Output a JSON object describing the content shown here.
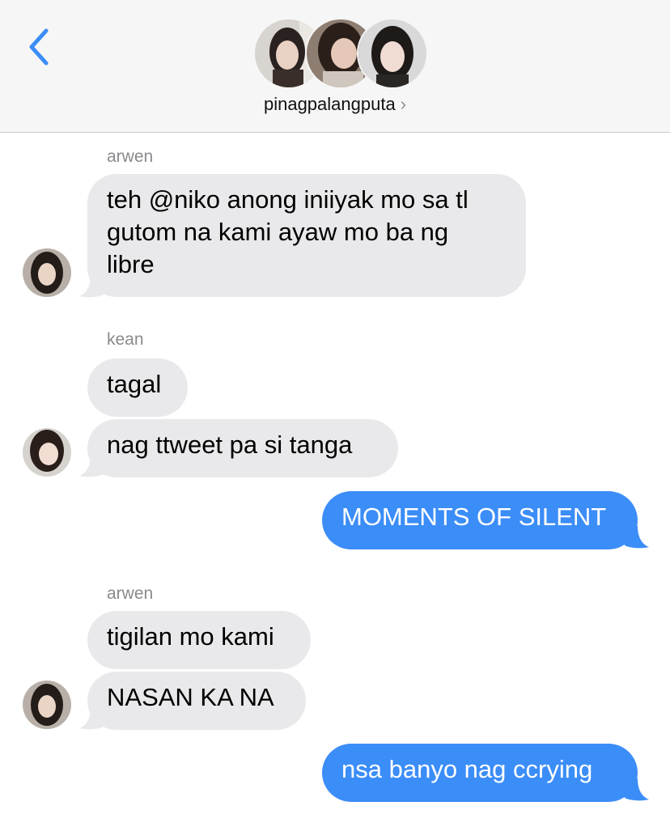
{
  "header": {
    "chat_name": "pinagpalangputa",
    "chevron": "›",
    "back_icon": "chevron-left-icon"
  },
  "colors": {
    "accent": "#3b8df8",
    "incoming_bubble": "#e9e9eb",
    "header_bg": "#f6f6f6"
  },
  "messages": [
    {
      "sender": "arwen",
      "text_lines": [
        "teh @niko anong iniiyak mo sa tl",
        "gutom na kami ayaw mo ba ng",
        "libre"
      ]
    },
    {
      "sender": "kean",
      "text": "tagal"
    },
    {
      "text": "nag ttweet pa si tanga"
    },
    {
      "text": "MOMENTS OF SILENT",
      "outgoing": true
    },
    {
      "sender": "arwen",
      "text": "tigilan mo kami"
    },
    {
      "text": "NASAN KA NA"
    },
    {
      "text": "nsa banyo nag ccrying",
      "outgoing": true
    }
  ]
}
